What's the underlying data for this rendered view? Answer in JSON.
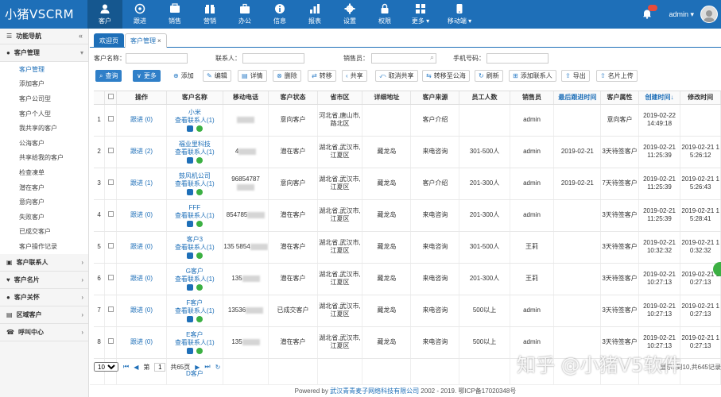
{
  "app": {
    "logo": "小猪VSCRM"
  },
  "nav": [
    {
      "label": "客户",
      "icon": "customer-icon"
    },
    {
      "label": "跟进",
      "icon": "followup-icon"
    },
    {
      "label": "销售",
      "icon": "sales-icon"
    },
    {
      "label": "营销",
      "icon": "marketing-icon"
    },
    {
      "label": "办公",
      "icon": "office-icon"
    },
    {
      "label": "信息",
      "icon": "info-icon"
    },
    {
      "label": "报表",
      "icon": "report-icon"
    },
    {
      "label": "设置",
      "icon": "settings-icon"
    },
    {
      "label": "权限",
      "icon": "lock-icon"
    },
    {
      "label": "更多 ▾",
      "icon": "more-icon"
    },
    {
      "label": "移动端 ▾",
      "icon": "mobile-icon"
    }
  ],
  "user": {
    "name": "admin ▾"
  },
  "sidebar": {
    "title": "功能导航",
    "collapse": "«",
    "groups": [
      {
        "label": "客户管理"
      },
      {
        "label": "客户联系人"
      },
      {
        "label": "客户名片"
      },
      {
        "label": "客户关怀"
      },
      {
        "label": "区域客户"
      },
      {
        "label": "呼叫中心"
      }
    ],
    "items": [
      "客户管理",
      "添加客户",
      "客户公司型",
      "客户个人型",
      "我共享的客户",
      "公海客户",
      "共享给我的客户",
      "检查凍单",
      "潜在客户",
      "意向客户",
      "失败客户",
      "已成交客户",
      "客户操作记录"
    ]
  },
  "tabs": [
    {
      "label": "欢迎页"
    },
    {
      "label": "客户管理",
      "close": "×"
    }
  ],
  "search": {
    "name_label": "客户名称：",
    "contact_label": "联系人：",
    "sales_label": "销售员：",
    "phone_label": "手机号码："
  },
  "toolbar": [
    "查询",
    "更多",
    "添加",
    "编辑",
    "详情",
    "删除",
    "转移",
    "共享",
    "取消共享",
    "转移至公海",
    "刷新",
    "添加联系人",
    "导出",
    "名片上传"
  ],
  "table": {
    "headers": [
      "",
      "操作",
      "客户名称",
      "移动电话",
      "客户状态",
      "省市区",
      "详细地址",
      "客户来源",
      "员工人数",
      "销售员",
      "最后跟进时间",
      "客户属性",
      "创建时间↓",
      "修改时间"
    ],
    "rows": [
      {
        "n": "1",
        "op": "跟进 (0)",
        "name": "小米",
        "contact": "查看联系人(1)",
        "phone": "",
        "status": "意向客户",
        "region": "河北省,唐山市,路北区",
        "addr": "",
        "source": "客户介绍",
        "staff": "",
        "sales": "admin",
        "last": "",
        "attr": "意向客户",
        "created": "2019-02-22 14:49:18",
        "modified": ""
      },
      {
        "n": "2",
        "op": "跟进 (2)",
        "name": "福业里科技",
        "contact": "查看联系人(1)",
        "phone": "4",
        "status": "潜在客户",
        "region": "湖北省,武汉市,江夏区",
        "addr": "藏龙岛",
        "source": "来电咨询",
        "staff": "301-500人",
        "sales": "admin",
        "last": "2019-02-21",
        "attr": "3天待签客户",
        "created": "2019-02-21 11:25:39",
        "modified": "2019-02-21 1 5:26:12"
      },
      {
        "n": "3",
        "op": "跟进 (1)",
        "name": "鼓风机公司",
        "contact": "查看联系人(1)",
        "phone": "96854787",
        "status": "意向客户",
        "region": "湖北省,武汉市,江夏区",
        "addr": "藏龙岛",
        "source": "客户介绍",
        "staff": "201-300人",
        "sales": "admin",
        "last": "2019-02-21",
        "attr": "7天待签客户",
        "created": "2019-02-21 11:25:39",
        "modified": "2019-02-21 1 5:26:43"
      },
      {
        "n": "4",
        "op": "跟进 (0)",
        "name": "FFF",
        "contact": "查看联系人(1)",
        "phone": "854785",
        "status": "潜在客户",
        "region": "湖北省,武汉市,江夏区",
        "addr": "藏龙岛",
        "source": "来电咨询",
        "staff": "201-300人",
        "sales": "admin",
        "last": "",
        "attr": "3天待签客户",
        "created": "2019-02-21 11:25:39",
        "modified": "2019-02-21 1 5:28:41"
      },
      {
        "n": "5",
        "op": "跟进 (0)",
        "name": "客户3",
        "contact": "查看联系人(1)",
        "phone": "135 5854",
        "status": "潜在客户",
        "region": "湖北省,武汉市,江夏区",
        "addr": "藏龙岛",
        "source": "来电咨询",
        "staff": "301-500人",
        "sales": "王莉",
        "last": "",
        "attr": "3天待签客户",
        "created": "2019-02-21 10:32:32",
        "modified": "2019-02-21 1 0:32:32"
      },
      {
        "n": "6",
        "op": "跟进 (0)",
        "name": "G客户",
        "contact": "查看联系人(1)",
        "phone": "135",
        "status": "潜在客户",
        "region": "湖北省,武汉市,江夏区",
        "addr": "藏龙岛",
        "source": "来电咨询",
        "staff": "201-300人",
        "sales": "王莉",
        "last": "",
        "attr": "3天待签客户",
        "created": "2019-02-21 10:27:13",
        "modified": "2019-02-21 1 0:27:13"
      },
      {
        "n": "7",
        "op": "跟进 (0)",
        "name": "F客户",
        "contact": "查看联系人(1)",
        "phone": "13536",
        "status": "已成交客户",
        "region": "湖北省,武汉市,江夏区",
        "addr": "藏龙岛",
        "source": "来电咨询",
        "staff": "500以上",
        "sales": "admin",
        "last": "",
        "attr": "3天待签客户",
        "created": "2019-02-21 10:27:13",
        "modified": "2019-02-21 1 0:27:13"
      },
      {
        "n": "8",
        "op": "跟进 (0)",
        "name": "E客户",
        "contact": "查看联系人(1)",
        "phone": "135",
        "status": "潜在客户",
        "region": "湖北省,武汉市,江夏区",
        "addr": "藏龙岛",
        "source": "来电咨询",
        "staff": "500以上",
        "sales": "admin",
        "last": "",
        "attr": "3天待签客户",
        "created": "2019-02-21 10:27:13",
        "modified": "2019-02-21 1 0:27:13"
      },
      {
        "n": "",
        "op": "",
        "name": "D客户",
        "contact": "",
        "phone": "",
        "status": "",
        "region": "",
        "addr": "",
        "source": "",
        "staff": "",
        "sales": "",
        "last": "",
        "attr": "",
        "created": "",
        "modified": ""
      }
    ]
  },
  "pager": {
    "size": "10",
    "page_prefix": "第",
    "page": "1",
    "page_total": "共65页",
    "summary": "显示1到10,共645记录"
  },
  "footer": {
    "prefix": "Powered by ",
    "company": "武汉青青麦子网络科技有限公司",
    "suffix": " 2002 - 2019. 鄂ICP备17020348号"
  },
  "watermark": "知乎 @小猪V5软件"
}
